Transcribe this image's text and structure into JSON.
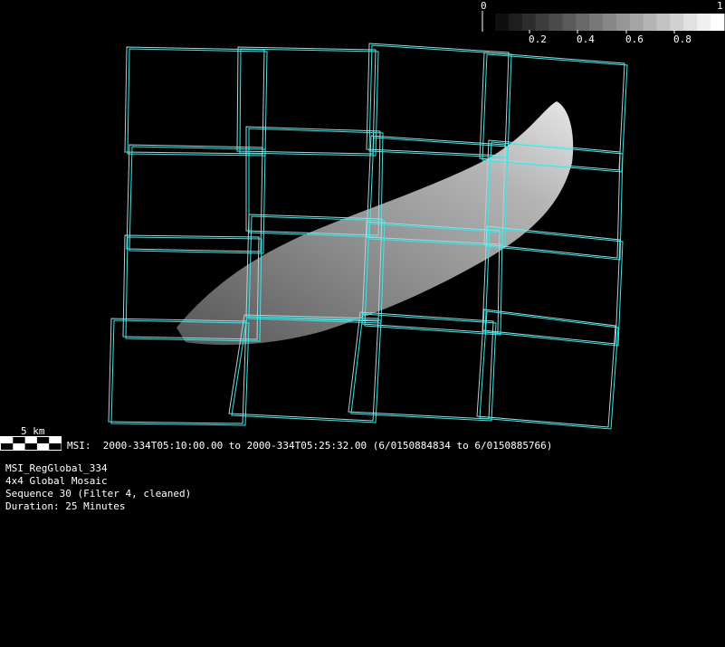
{
  "colorbar": {
    "min_label": "0",
    "max_label": "1",
    "tick_labels": [
      "0.2",
      "0.4",
      "0.6",
      "0.8"
    ],
    "steps": 17
  },
  "scale_bar": {
    "label": "5 km"
  },
  "observation": {
    "line": "MSI:  2000-334T05:10:00.00 to 2000-334T05:25:32.00 (6/0150884834 to 6/0150885766)"
  },
  "info": {
    "name": "MSI_RegGlobal_334",
    "mosaic": "4x4 Global Mosaic",
    "sequence": "Sequence 30 (Filter 4, cleaned)",
    "duration": "Duration: 25 Minutes"
  },
  "colors": {
    "frame": "#00ffff",
    "frame_alt": "#c8c8c8",
    "background": "#000000"
  }
}
